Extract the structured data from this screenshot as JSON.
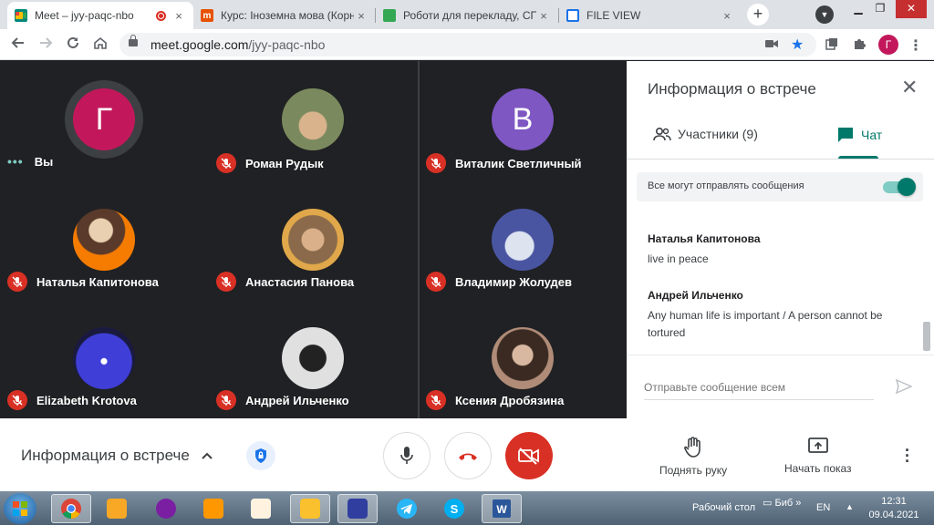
{
  "browser": {
    "tabs": [
      {
        "title": "Meet – jyy-paqc-nbo",
        "recording": true,
        "favicon_color": "#00897b"
      },
      {
        "title": "Курс: Іноземна мова (Корне",
        "favicon_color": "#e65100"
      },
      {
        "title": "Роботи для перекладу, СПА",
        "favicon_color": "#34a853"
      },
      {
        "title": "FILE VIEW",
        "favicon_color": "#1a73e8"
      }
    ],
    "tab_close_glyph": "×",
    "new_tab_glyph": "+",
    "url_host": "meet.google.com",
    "url_path": "/jyy-paqc-nbo",
    "profile_initial": "Г"
  },
  "participants": [
    {
      "name": "Вы",
      "avatar_type": "letter",
      "letter": "Г",
      "avatar_color": "#c2185b",
      "status": "speaking-dots"
    },
    {
      "name": "Роман Рудык",
      "avatar_type": "photo",
      "photo_colors": [
        "#7b8a5e",
        "#d9b38c"
      ],
      "status": "muted"
    },
    {
      "name": "Виталик Светличный",
      "avatar_type": "letter",
      "letter": "В",
      "avatar_color": "#7e57c2",
      "status": "muted"
    },
    {
      "name": "Наталья Капитонова",
      "avatar_type": "photo",
      "photo_colors": [
        "#f57c00",
        "#e8d0b0"
      ],
      "status": "muted"
    },
    {
      "name": "Анастасия Панова",
      "avatar_type": "photo",
      "photo_colors": [
        "#e0a84a",
        "#8a6a4a"
      ],
      "status": "muted"
    },
    {
      "name": "Владимир Жолудев",
      "avatar_type": "photo",
      "photo_colors": [
        "#4a55a2",
        "#dde4f0"
      ],
      "status": "muted"
    },
    {
      "name": "Elizabeth Krotova",
      "avatar_type": "photo",
      "photo_colors": [
        "#3f3fd8",
        "#1a1a40"
      ],
      "status": "muted"
    },
    {
      "name": "Андрей Ильченко",
      "avatar_type": "photo",
      "photo_colors": [
        "#e0e0e0",
        "#222222"
      ],
      "status": "muted"
    },
    {
      "name": "Ксения Дробязина",
      "avatar_type": "photo",
      "photo_colors": [
        "#b08c78",
        "#3a2a22"
      ],
      "status": "muted"
    }
  ],
  "panel": {
    "title": "Информация о встрече",
    "tab_people": "Участники (9)",
    "tab_chat": "Чат",
    "allow_messages_label": "Все могут отправлять сообщения",
    "allow_messages_on": true,
    "messages": [
      {
        "sender": "Наталья Капитонова",
        "text": "live in peace"
      },
      {
        "sender": "Андрей Ильченко",
        "text": "Any human life is important / A person cannot be tortured"
      }
    ],
    "input_placeholder": "Отправьте сообщение всем"
  },
  "bottombar": {
    "meeting_info": "Информация о встрече",
    "raise_hand": "Поднять руку",
    "present": "Начать показ"
  },
  "taskbar": {
    "desktop_label": "Рабочий стол",
    "lib_label": "Биб",
    "lang": "EN",
    "time": "12:31",
    "date": "09.04.2021"
  },
  "colors": {
    "accent": "#00796b",
    "danger": "#d93025",
    "grid_bg": "#202124"
  }
}
